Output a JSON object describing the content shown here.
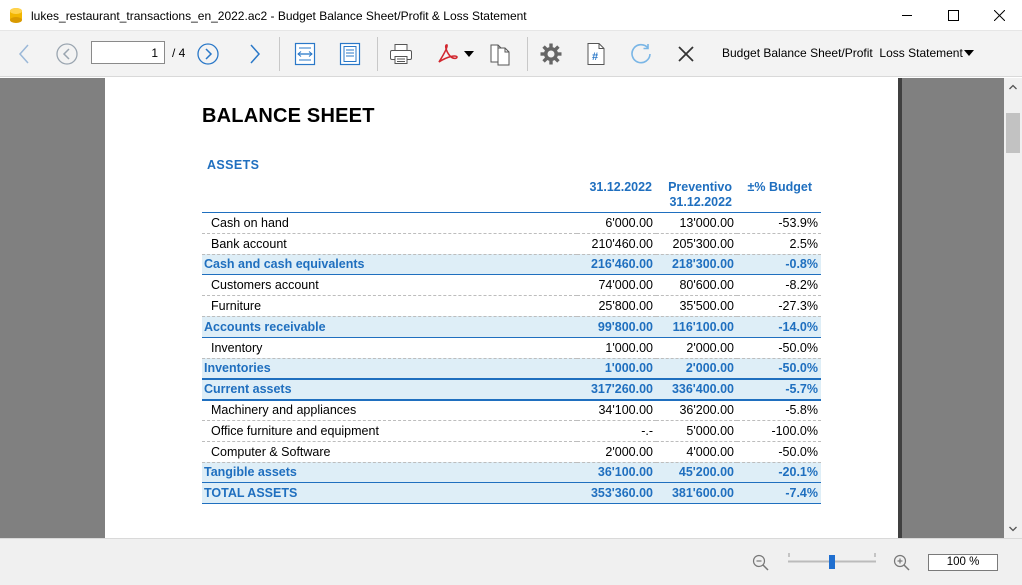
{
  "window": {
    "title": "lukes_restaurant_transactions_en_2022.ac2 - Budget Balance Sheet/Profit & Loss Statement"
  },
  "toolbar": {
    "page_current": "1",
    "page_total": "/ 4",
    "report_selector": "Budget Balance Sheet/Profit  Loss Statement",
    "icons": [
      "back-icon",
      "prev-page-icon",
      "next-page-icon",
      "forward-icon",
      "fit-width-icon",
      "fit-page-icon",
      "print-icon",
      "pdf-icon",
      "copy-icon",
      "settings-icon",
      "page-number-icon",
      "refresh-icon",
      "close-icon"
    ]
  },
  "report": {
    "title": "BALANCE SHEET",
    "section": "ASSETS",
    "columns": {
      "col1": "31.12.2022",
      "col2_line1": "Preventivo",
      "col2_line2": "31.12.2022",
      "col3": "±% Budget"
    },
    "rows": [
      {
        "label": "Cash on hand",
        "v1": "6'000.00",
        "v2": "13'000.00",
        "v3": "-53.9%",
        "type": "item"
      },
      {
        "label": "Bank account",
        "v1": "210'460.00",
        "v2": "205'300.00",
        "v3": "2.5%",
        "type": "item"
      },
      {
        "label": "Cash and cash equivalents",
        "v1": "216'460.00",
        "v2": "218'300.00",
        "v3": "-0.8%",
        "type": "tot"
      },
      {
        "label": "Customers account",
        "v1": "74'000.00",
        "v2": "80'600.00",
        "v3": "-8.2%",
        "type": "item"
      },
      {
        "label": "Furniture",
        "v1": "25'800.00",
        "v2": "35'500.00",
        "v3": "-27.3%",
        "type": "item"
      },
      {
        "label": "Accounts receivable",
        "v1": "99'800.00",
        "v2": "116'100.00",
        "v3": "-14.0%",
        "type": "tot"
      },
      {
        "label": "Inventory",
        "v1": "1'000.00",
        "v2": "2'000.00",
        "v3": "-50.0%",
        "type": "item"
      },
      {
        "label": "Inventories",
        "v1": "1'000.00",
        "v2": "2'000.00",
        "v3": "-50.0%",
        "type": "tot strong"
      },
      {
        "label": "Current assets",
        "v1": "317'260.00",
        "v2": "336'400.00",
        "v3": "-5.7%",
        "type": "tot strong"
      },
      {
        "label": "Machinery and appliances",
        "v1": "34'100.00",
        "v2": "36'200.00",
        "v3": "-5.8%",
        "type": "item"
      },
      {
        "label": "Office furniture and equipment",
        "v1": "-.-",
        "v2": "5'000.00",
        "v3": "-100.0%",
        "type": "item"
      },
      {
        "label": "Computer & Software",
        "v1": "2'000.00",
        "v2": "4'000.00",
        "v3": "-50.0%",
        "type": "item"
      },
      {
        "label": "Tangible assets",
        "v1": "36'100.00",
        "v2": "45'200.00",
        "v3": "-20.1%",
        "type": "tot"
      },
      {
        "label": "TOTAL ASSETS",
        "v1": "353'360.00",
        "v2": "381'600.00",
        "v3": "-7.4%",
        "type": "tot"
      }
    ]
  },
  "statusbar": {
    "zoom": "100 %",
    "zoom_level": 100
  },
  "colors": {
    "accent": "#1f6fbf",
    "total_row_bg": "#deeef7",
    "doc_bg": "#808080"
  }
}
